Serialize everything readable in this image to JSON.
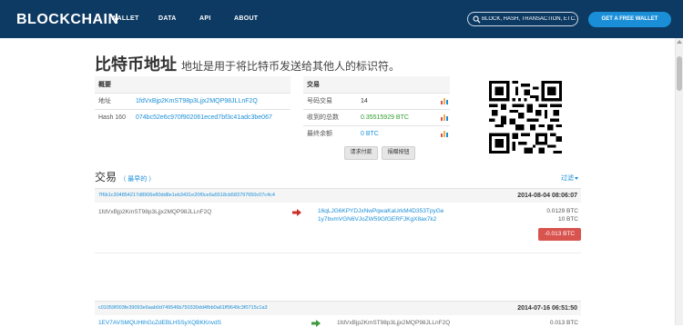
{
  "nav": {
    "brand": "BLOCKCHAIN",
    "items": [
      "WALLET",
      "DATA",
      "API",
      "ABOUT"
    ],
    "search_placeholder": "BLOCK, HASH, TRANSACTION, ETC...",
    "cta": "GET A FREE WALLET"
  },
  "page": {
    "title_big": "比特币地址",
    "title_sub": "地址是用于将比特币发送给其他人的标识符。"
  },
  "summary": {
    "header": "概要",
    "rows": [
      {
        "key": "地址",
        "value": "1fdVxBjp2KmST98p3Ljjx2MQP98JLLnF2Q"
      },
      {
        "key": "Hash 160",
        "value": "074bc52e6c970f902061eced7bf3c41adc3be067"
      }
    ]
  },
  "txinfo": {
    "header": "交易",
    "rows": [
      {
        "key": "号码交易",
        "value": "14"
      },
      {
        "key": "收到的总数",
        "value": "0.35515929 BTC"
      },
      {
        "key": "最终余额",
        "value": "0 BTC"
      }
    ]
  },
  "buttons": {
    "request": "请求付款",
    "donate": "捐赠按钮"
  },
  "colors": {
    "navbar": "#0d3a63",
    "accent": "#1a8fd8",
    "negative": "#d9534f",
    "arrow_out": "#c9302c",
    "arrow_in": "#3c9a3c"
  },
  "transactions": {
    "title": "交易",
    "oldest_label": "（ 最早的 ）",
    "filter_label": "过滤",
    "items": [
      {
        "hash": "7f6b1c304854217d8906e80dd8e1eb3431e20f0ce6a5518cb583797650c07c4c4",
        "time": "2014-08-04 08:06:07",
        "from": "1fdVxBjp2KmST98p3Ljjx2MQP98JLLnF2Q",
        "to": [
          "16qLJG6KPYDJxNwPqwaKaUrkM4D353TpyGe",
          "1y7bvmVGN6VJoZW59GfGERFJKgX8ax7k2"
        ],
        "amounts": [
          "0.0129 BTC",
          "10 BTC"
        ],
        "net": "-0.013 BTC"
      },
      {
        "hash": "c01059f003fe39093e6aab0d749546b750330dd4fbb0a61ff9649c3f0715c1a3",
        "time": "2014-07-16 06:51:50",
        "from": "1EV7AVSMQUHthGcZdEBLH5SyXQBKKnvdS",
        "to": [
          "1fdVxBjp2KmST98p3Ljjx2MQP98JLLnF2Q"
        ],
        "amounts": [
          "0.013 BTC"
        ]
      }
    ]
  }
}
